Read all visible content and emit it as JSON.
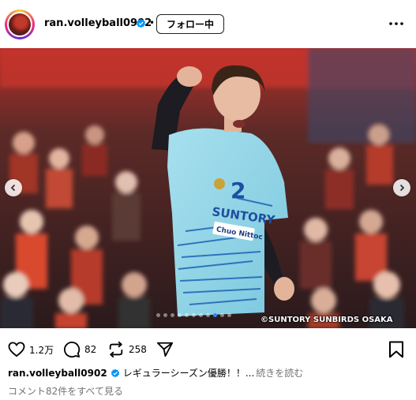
{
  "header": {
    "username": "ran.volleyball0902",
    "separator": "•",
    "follow_label": "フォロー中"
  },
  "photo": {
    "copyright": "©SUNTORY SUNBIRDS OSAKA",
    "jersey_number": "2",
    "jersey_sponsor": "SUNTORY",
    "jersey_sub_sponsor": "Chuo Nittoc",
    "carousel_dots": 11,
    "carousel_active_index": 8
  },
  "actions": {
    "likes": "1.2万",
    "comments": "82",
    "reposts": "258"
  },
  "caption": {
    "username": "ran.volleyball0902",
    "text": "レギュラーシーズン優勝！！...",
    "more_label": "続きを読む"
  },
  "comments_link": "コメント82件をすべて見る",
  "colors": {
    "verified": "#0095f6",
    "jersey": "#8fd4e6",
    "arena_red": "#a8241f",
    "secondary_text": "#737373"
  }
}
